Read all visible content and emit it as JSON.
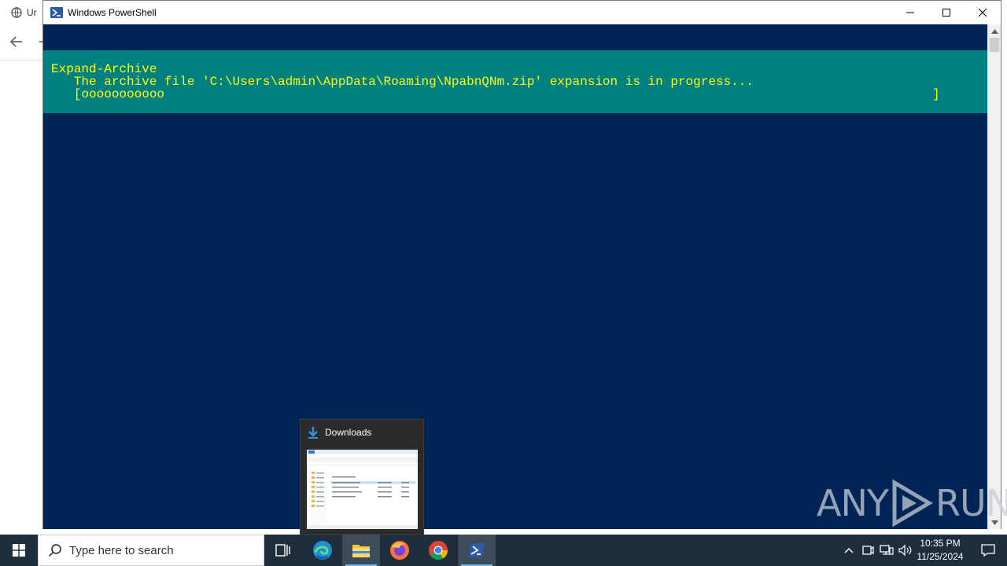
{
  "background_browser": {
    "tab_text": "Ur"
  },
  "window": {
    "title": "Windows PowerShell",
    "minimize_label": "Minimize",
    "maximize_label": "Maximize",
    "close_label": "Close"
  },
  "console": {
    "progress_activity": "Expand-Archive",
    "progress_status": "   The archive file 'C:\\Users\\admin\\AppData\\Roaming\\NpabnQNm.zip' expansion is in progress...",
    "progress_bar_text": "   [ooooooooooo",
    "progress_bar_end": "]",
    "progress_fraction": 0.11,
    "colors": {
      "console_background": "#012456",
      "progress_background": "#008080",
      "progress_text": "#ffff00"
    }
  },
  "taskbar_thumbnail": {
    "title": "Downloads",
    "icon": "download-arrow-icon"
  },
  "watermark": {
    "text_left": "ANY",
    "text_right": "RUN"
  },
  "taskbar": {
    "search_placeholder": "Type here to search",
    "apps": [
      {
        "name": "task-view",
        "icon": "task-view-icon"
      },
      {
        "name": "edge",
        "icon": "edge-icon"
      },
      {
        "name": "file-explorer",
        "icon": "folder-icon"
      },
      {
        "name": "firefox",
        "icon": "firefox-icon"
      },
      {
        "name": "chrome",
        "icon": "chrome-icon"
      },
      {
        "name": "powershell",
        "icon": "powershell-icon"
      }
    ],
    "clock_time": "10:35 PM",
    "clock_date": "11/25/2024"
  }
}
